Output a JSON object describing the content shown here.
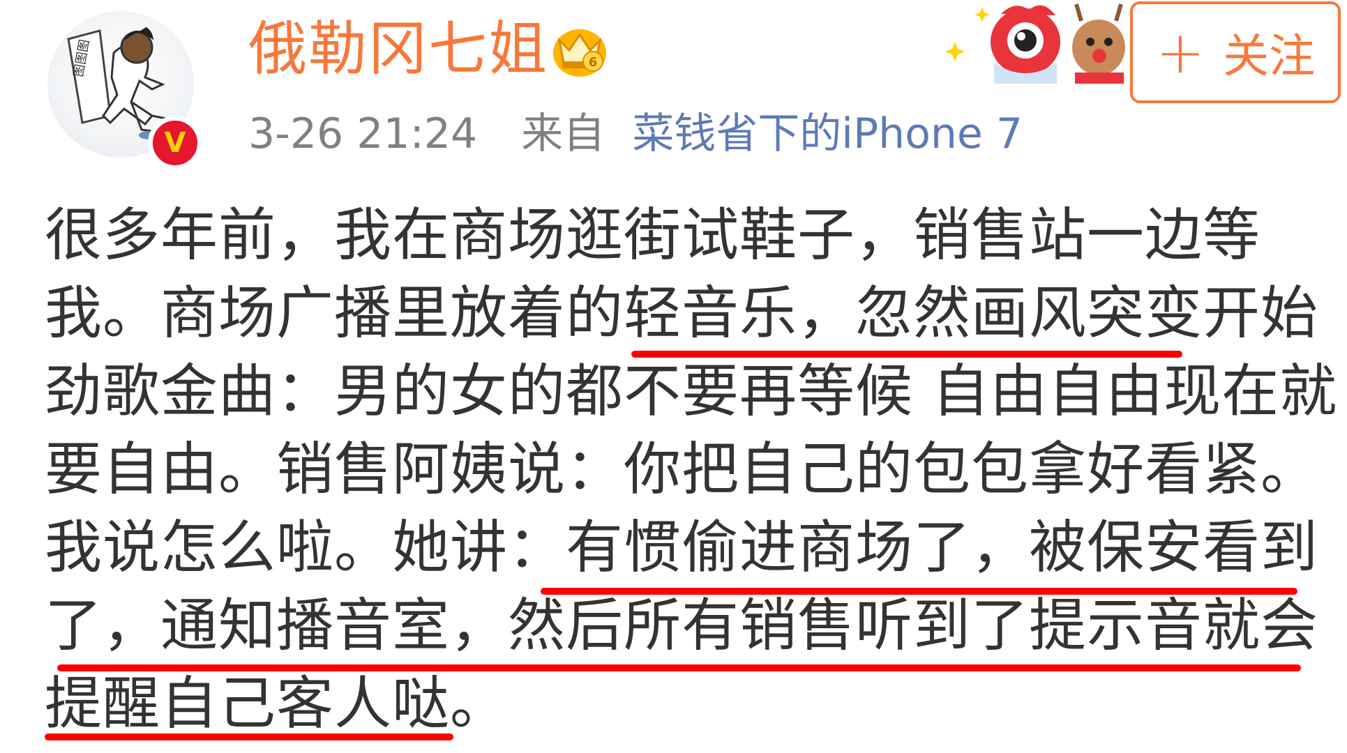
{
  "post": {
    "author": {
      "name": "俄勒冈七姐",
      "avatar_icon": "avatar-illustration",
      "verified_icon": "verified-v-icon",
      "verified_badge": "V",
      "member_icon": "crown-icon",
      "member_level": "6"
    },
    "meta": {
      "time": "3-26 21:24",
      "from_label": "来自",
      "source": "菜钱省下的iPhone 7"
    },
    "follow_button": {
      "plus": "+",
      "label": "关注"
    },
    "body_lines": [
      "很多年前，我在商场逛街试鞋子，销售站一边等",
      "我。商场广播里放着的轻音乐，忽然画风突变开始",
      "劲歌金曲：男的女的都不要再等候 自由自由现在就",
      "要自由。销售阿姨说：你把自己的包包拿好看紧。",
      "我说怎么啦。她讲：有惯偷进商场了，被保安看到",
      "了，通知播音室，然后所有销售听到了提示音就会",
      "提醒自己客人哒。"
    ]
  },
  "colors": {
    "accent": "#f7783a",
    "link": "#5d7ab7",
    "meta_gray": "#808080",
    "text": "#333333",
    "highlight_underline": "#ff0000",
    "verified_red": "#e6162d"
  }
}
